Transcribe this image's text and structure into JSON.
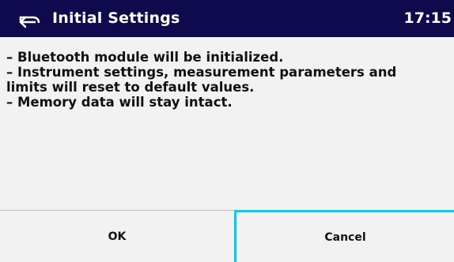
{
  "header": {
    "title": "Initial Settings",
    "time": "17:15"
  },
  "message": {
    "lines": [
      "– Bluetooth module will be initialized.",
      "– Instrument settings, measurement parameters and",
      "limits will reset to default values.",
      "– Memory data will stay intact."
    ]
  },
  "buttons": {
    "ok_label": "OK",
    "cancel_label": "Cancel"
  },
  "colors": {
    "header_bg": "#0f0a4d",
    "focus_border": "#1fc3e0",
    "body_bg": "#f2f2f2"
  },
  "icons": {
    "back": "back-arrow-icon"
  }
}
